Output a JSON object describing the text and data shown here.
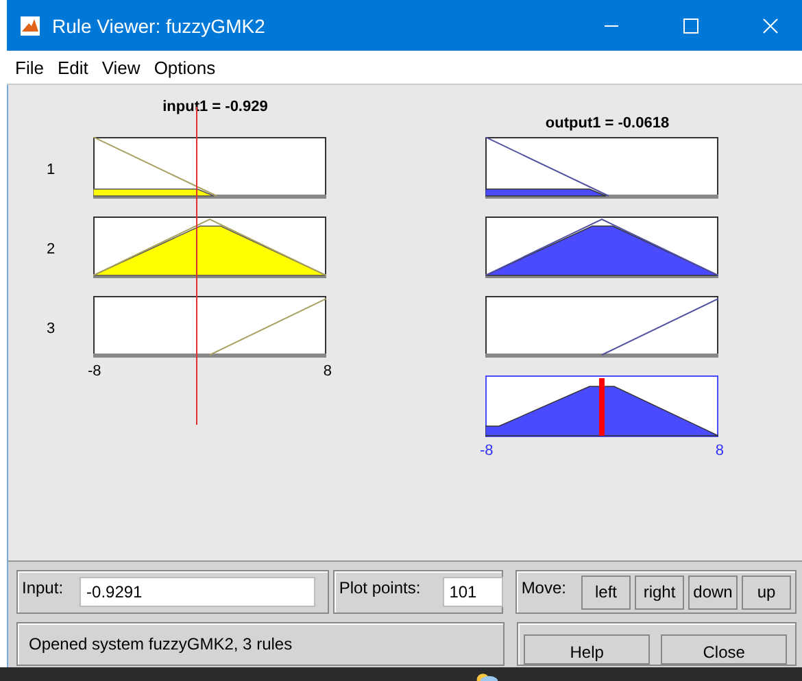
{
  "window": {
    "title": "Rule Viewer: fuzzyGMK2"
  },
  "menu": [
    "File",
    "Edit",
    "View",
    "Options"
  ],
  "input_plot": {
    "title": "input1 = -0.929",
    "xmin": "-8",
    "xmax": "8"
  },
  "output_plot": {
    "title": "output1 = -0.0618",
    "xmin": "-8",
    "xmax": "8"
  },
  "rules": [
    {
      "number": "1"
    },
    {
      "number": "2"
    },
    {
      "number": "3"
    }
  ],
  "input_field": {
    "label": "Input:",
    "value": "-0.9291"
  },
  "plot_points": {
    "label": "Plot points:",
    "value": "101"
  },
  "move": {
    "label": "Move:",
    "buttons": [
      "left",
      "right",
      "down",
      "up"
    ]
  },
  "status": "Opened system fuzzyGMK2, 3 rules",
  "buttons": [
    "Help",
    "Close"
  ]
}
